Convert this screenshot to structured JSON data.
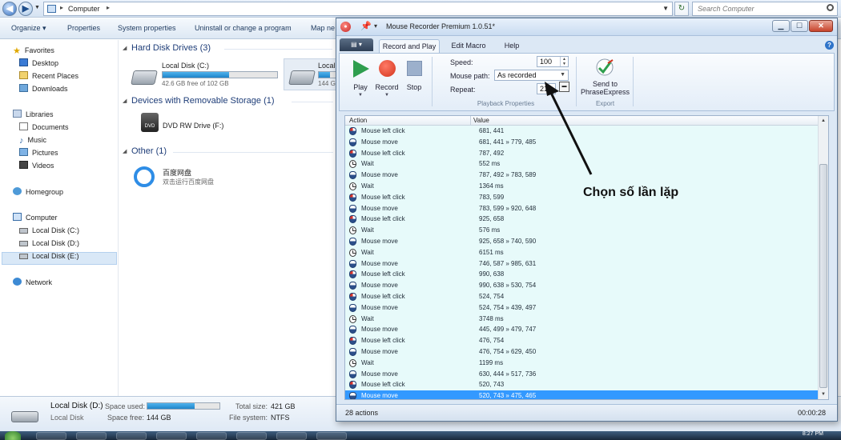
{
  "explorer": {
    "address": "Computer",
    "search_placeholder": "Search Computer",
    "commands": [
      "Organize ▾",
      "Properties",
      "System properties",
      "Uninstall or change a program",
      "Map ne"
    ],
    "nav": {
      "favorites": "Favorites",
      "desktop": "Desktop",
      "recent_places": "Recent Places",
      "downloads": "Downloads",
      "libraries": "Libraries",
      "documents": "Documents",
      "music": "Music",
      "pictures": "Pictures",
      "videos": "Videos",
      "homegroup": "Homegroup",
      "computer": "Computer",
      "disk_c": "Local Disk (C:)",
      "disk_d": "Local Disk (D:)",
      "disk_e": "Local Disk (E:)",
      "network": "Network"
    },
    "groups": {
      "hdd": "Hard Disk Drives (3)",
      "removable": "Devices with Removable Storage (1)",
      "other": "Other (1)"
    },
    "drive_c": {
      "name": "Local Disk (C:)",
      "free": "42.6 GB free of 102 GB",
      "used_fraction": 0.58
    },
    "drive_d_partial": {
      "name": "Local",
      "free": "144 G",
      "used_fraction": 0.66
    },
    "dvd": {
      "name": "DVD RW Drive (F:)",
      "icon_text": "DVD"
    },
    "other_item": {
      "name": "百度网盘",
      "sub": "双击运行百度网盘"
    },
    "details": {
      "name": "Local Disk (D:)",
      "type": "Local Disk",
      "space_used_label": "Space used:",
      "space_free_label": "Space free:",
      "space_free": "144 GB",
      "total_size_label": "Total size:",
      "total_size": "421 GB",
      "file_system_label": "File system:",
      "file_system": "NTFS",
      "used_fraction": 0.66
    },
    "clock": "8:27 PM"
  },
  "recorder": {
    "title": "Mouse Recorder Premium 1.0.51*",
    "tabs": [
      "Record and Play",
      "Edit Macro",
      "Help"
    ],
    "buttons": {
      "play": "Play",
      "record": "Record",
      "stop": "Stop",
      "export": "Send to PhraseExpress"
    },
    "properties": {
      "speed_label": "Speed:",
      "speed": "100",
      "path_label": "Mouse path:",
      "path": "As recorded",
      "repeat_label": "Repeat:",
      "repeat": "21"
    },
    "group_labels": {
      "playback": "Playback Properties",
      "export": "Export"
    },
    "columns": {
      "action": "Action",
      "value": "Value"
    },
    "rows": [
      {
        "icon": "mouse-left",
        "action": "Mouse left click",
        "value": "681, 441"
      },
      {
        "icon": "mouse",
        "action": "Mouse move",
        "value": "681, 441 » 779, 485"
      },
      {
        "icon": "mouse-left",
        "action": "Mouse left click",
        "value": "787, 492"
      },
      {
        "icon": "clock",
        "action": "Wait",
        "value": "552 ms"
      },
      {
        "icon": "mouse",
        "action": "Mouse move",
        "value": "787, 492 » 783, 589"
      },
      {
        "icon": "clock",
        "action": "Wait",
        "value": "1364 ms"
      },
      {
        "icon": "mouse-left",
        "action": "Mouse left click",
        "value": "783, 599"
      },
      {
        "icon": "mouse",
        "action": "Mouse move",
        "value": "783, 599 » 920, 648"
      },
      {
        "icon": "mouse-left",
        "action": "Mouse left click",
        "value": "925, 658"
      },
      {
        "icon": "clock",
        "action": "Wait",
        "value": "576 ms"
      },
      {
        "icon": "mouse",
        "action": "Mouse move",
        "value": "925, 658 » 740, 590"
      },
      {
        "icon": "clock",
        "action": "Wait",
        "value": "6151 ms"
      },
      {
        "icon": "mouse",
        "action": "Mouse move",
        "value": "746, 587 » 985, 631"
      },
      {
        "icon": "mouse-left",
        "action": "Mouse left click",
        "value": "990, 638"
      },
      {
        "icon": "mouse",
        "action": "Mouse move",
        "value": "990, 638 » 530, 754"
      },
      {
        "icon": "mouse-left",
        "action": "Mouse left click",
        "value": "524, 754"
      },
      {
        "icon": "mouse",
        "action": "Mouse move",
        "value": "524, 754 » 439, 497"
      },
      {
        "icon": "clock",
        "action": "Wait",
        "value": "3748 ms"
      },
      {
        "icon": "mouse",
        "action": "Mouse move",
        "value": "445, 499 » 479, 747"
      },
      {
        "icon": "mouse-left",
        "action": "Mouse left click",
        "value": "476, 754"
      },
      {
        "icon": "mouse",
        "action": "Mouse move",
        "value": "476, 754 » 629, 450"
      },
      {
        "icon": "clock",
        "action": "Wait",
        "value": "1199 ms"
      },
      {
        "icon": "mouse",
        "action": "Mouse move",
        "value": "630, 444 » 517, 736"
      },
      {
        "icon": "mouse-left",
        "action": "Mouse left click",
        "value": "520, 743"
      },
      {
        "icon": "mouse",
        "action": "Mouse move",
        "value": "520, 743 » 475, 465",
        "selected": true
      }
    ],
    "status": {
      "count": "28 actions",
      "time": "00:00:28"
    }
  },
  "annotation": {
    "text": "Chọn số lần lặp"
  }
}
